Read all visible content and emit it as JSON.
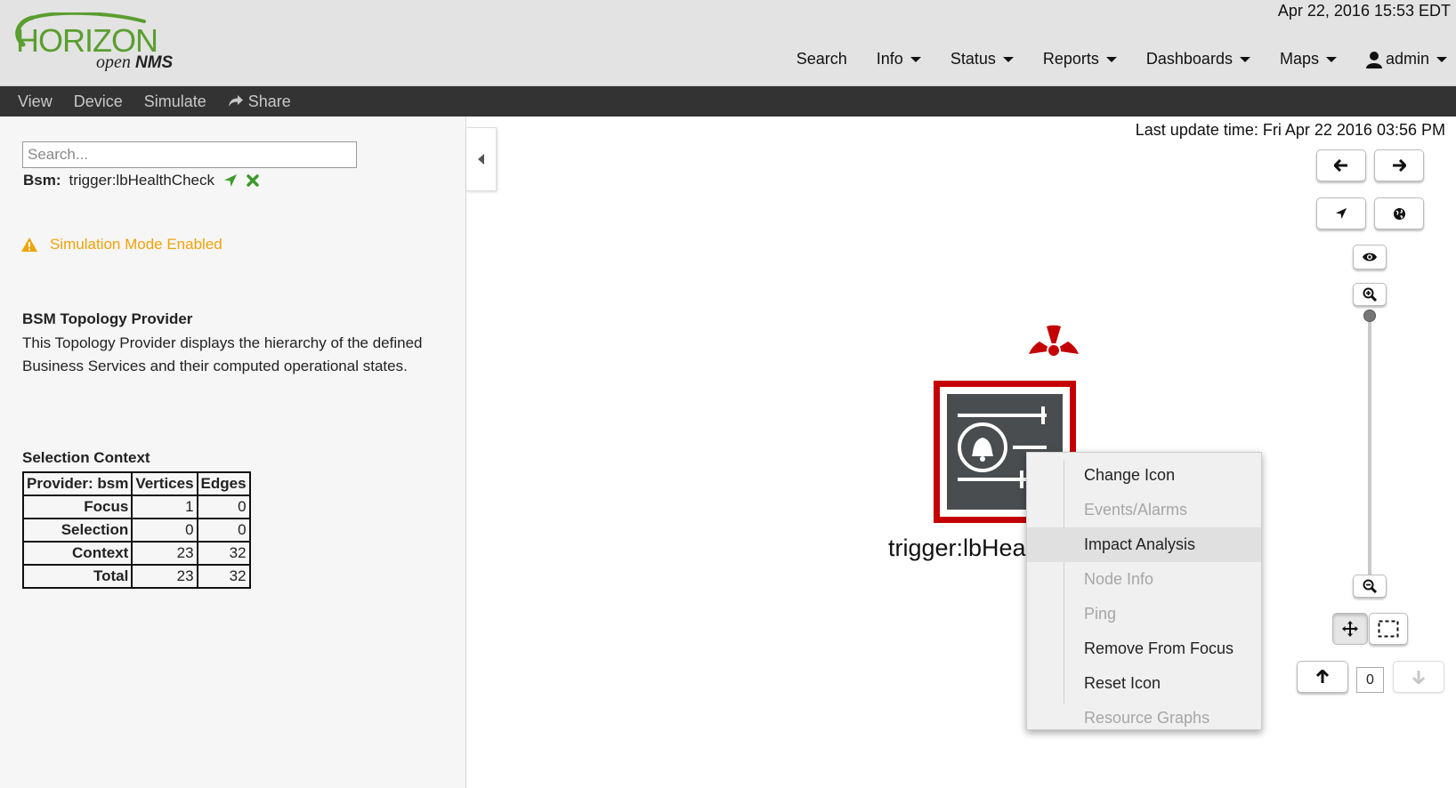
{
  "header": {
    "datetime": "Apr 22, 2016 15:53 EDT",
    "logo": {
      "brand": "HORIZON",
      "product_light": "open",
      "product_bold": "NMS"
    },
    "nav": [
      {
        "label": "Search"
      },
      {
        "label": "Info"
      },
      {
        "label": "Status"
      },
      {
        "label": "Reports"
      },
      {
        "label": "Dashboards"
      },
      {
        "label": "Maps"
      }
    ],
    "user": "admin"
  },
  "submenu": {
    "view": "View",
    "device": "Device",
    "simulate": "Simulate",
    "share": "Share"
  },
  "left": {
    "search_placeholder": "Search...",
    "focus": {
      "label": "Bsm:",
      "value": "trigger:lbHealthCheck"
    },
    "simulation_text": "Simulation Mode Enabled",
    "provider_title": "BSM Topology Provider",
    "provider_desc": "This Topology Provider displays the hierarchy of the defined Business Services and their computed operational states.",
    "selection_title": "Selection Context",
    "table": {
      "headers": [
        "Provider: bsm",
        "Vertices",
        "Edges"
      ],
      "rows": [
        {
          "label": "Focus",
          "vertices": "1",
          "edges": "0"
        },
        {
          "label": "Selection",
          "vertices": "0",
          "edges": "0"
        },
        {
          "label": "Context",
          "vertices": "23",
          "edges": "32"
        },
        {
          "label": "Total",
          "vertices": "23",
          "edges": "32"
        }
      ]
    }
  },
  "map": {
    "last_update": "Last update time: Fri Apr 22 2016 03:56 PM",
    "semantic_zoom_level": "0",
    "node_label": "trigger:lbHea",
    "context_menu": [
      {
        "label": "Change Icon",
        "enabled": true
      },
      {
        "label": "Events/Alarms",
        "enabled": false
      },
      {
        "label": "Impact Analysis",
        "enabled": true
      },
      {
        "label": "Node Info",
        "enabled": false
      },
      {
        "label": "Ping",
        "enabled": false
      },
      {
        "label": "Remove From Focus",
        "enabled": true
      },
      {
        "label": "Reset Icon",
        "enabled": true
      },
      {
        "label": "Resource Graphs",
        "enabled": false
      }
    ]
  },
  "colors": {
    "alarm_red": "#c40000",
    "warning_orange": "#f0a30a",
    "brand_green": "#5a9e2f",
    "submenu_bg": "#333333"
  }
}
